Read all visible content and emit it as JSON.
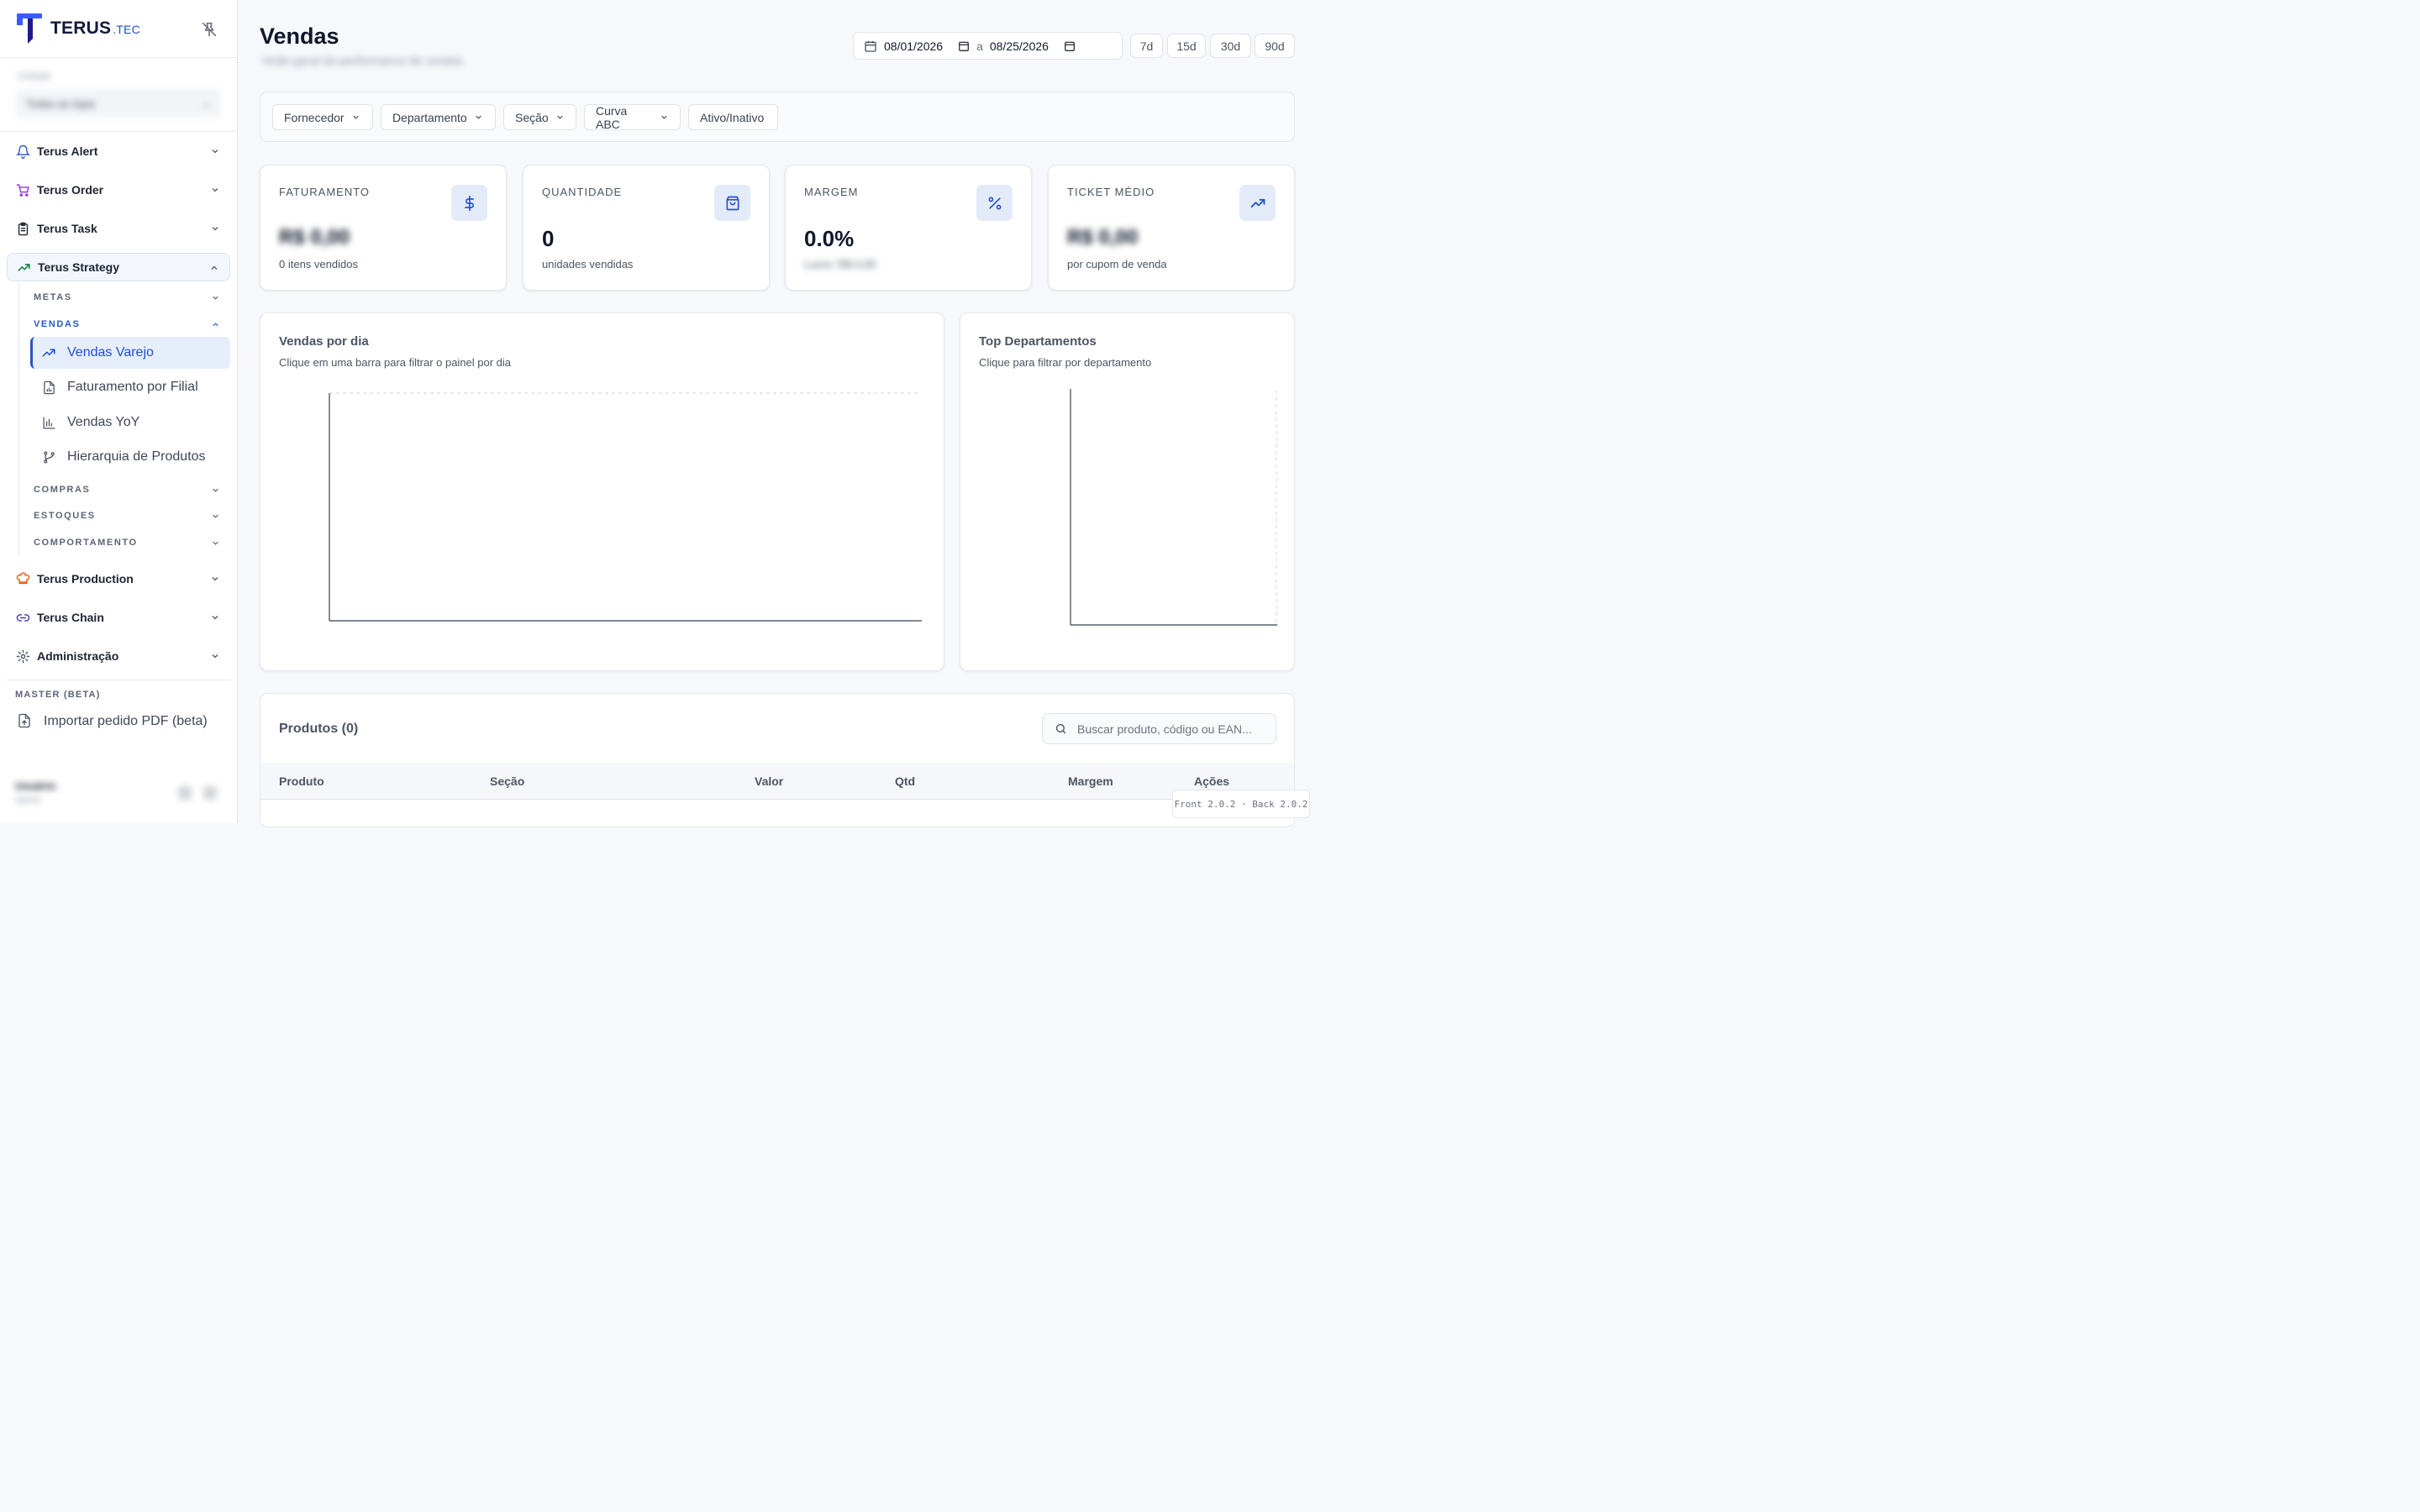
{
  "brand": {
    "name": "TERUS",
    "suffix": ".TEC"
  },
  "store": {
    "label": "Unidade",
    "value": "Todas as lojas"
  },
  "nav": {
    "alert": "Terus Alert",
    "order": "Terus Order",
    "task": "Terus Task",
    "strategy": "Terus Strategy",
    "production": "Terus Production",
    "chain": "Terus Chain",
    "admin": "Administração"
  },
  "strategy_sub": {
    "metas": "METAS",
    "vendas": "VENDAS",
    "compras": "COMPRAS",
    "estoques": "ESTOQUES",
    "comportamento": "COMPORTAMENTO"
  },
  "vendas_items": {
    "varejo": "Vendas Varejo",
    "filial": "Faturamento por Filial",
    "yoy": "Vendas YoY",
    "hierarquia": "Hierarquia de Produtos"
  },
  "master": {
    "label": "MASTER (BETA)",
    "pdf": "Importar pedido PDF (beta)"
  },
  "user": {
    "name": "Usuário",
    "role": "Admin"
  },
  "header": {
    "title": "Vendas",
    "subtitle": "Visão geral da performance de vendas",
    "date_from": "08/01/2026",
    "date_sep": "a",
    "date_to": "08/25/2026",
    "quick": [
      "7d",
      "15d",
      "30d",
      "90d"
    ]
  },
  "filters": {
    "fornecedor": "Fornecedor",
    "departamento": "Departamento",
    "secao": "Seção",
    "curva": "Curva ABC",
    "ativo": "Ativo/Inativo"
  },
  "kpis": {
    "faturamento": {
      "title": "FATURAMENTO",
      "value": "R$ 0,00",
      "sub": "0 itens vendidos"
    },
    "quantidade": {
      "title": "QUANTIDADE",
      "value": "0",
      "sub": "unidades vendidas"
    },
    "margem": {
      "title": "MARGEM",
      "value": "0.0%",
      "sub": "Lucro: R$ 0,00"
    },
    "ticket": {
      "title": "TICKET MÉDIO",
      "value": "R$ 0,00",
      "sub": "por cupom de venda"
    }
  },
  "charts": {
    "dia": {
      "title": "Vendas por dia",
      "subtitle": "Clique em uma barra para filtrar o painel por dia"
    },
    "dept": {
      "title": "Top Departamentos",
      "subtitle": "Clique para filtrar por departamento"
    }
  },
  "products": {
    "title": "Produtos (0)",
    "search_placeholder": "Buscar produto, código ou EAN...",
    "columns": [
      "Produto",
      "Seção",
      "Valor",
      "Qtd",
      "Margem",
      "Ações"
    ]
  },
  "version": {
    "text": "Front 2.0.2 · Back 2.0.2"
  },
  "colors": {
    "accent": "#2456c9",
    "brand": "#1d4ed8",
    "production": "#ea580c",
    "order": "#9333ea"
  }
}
